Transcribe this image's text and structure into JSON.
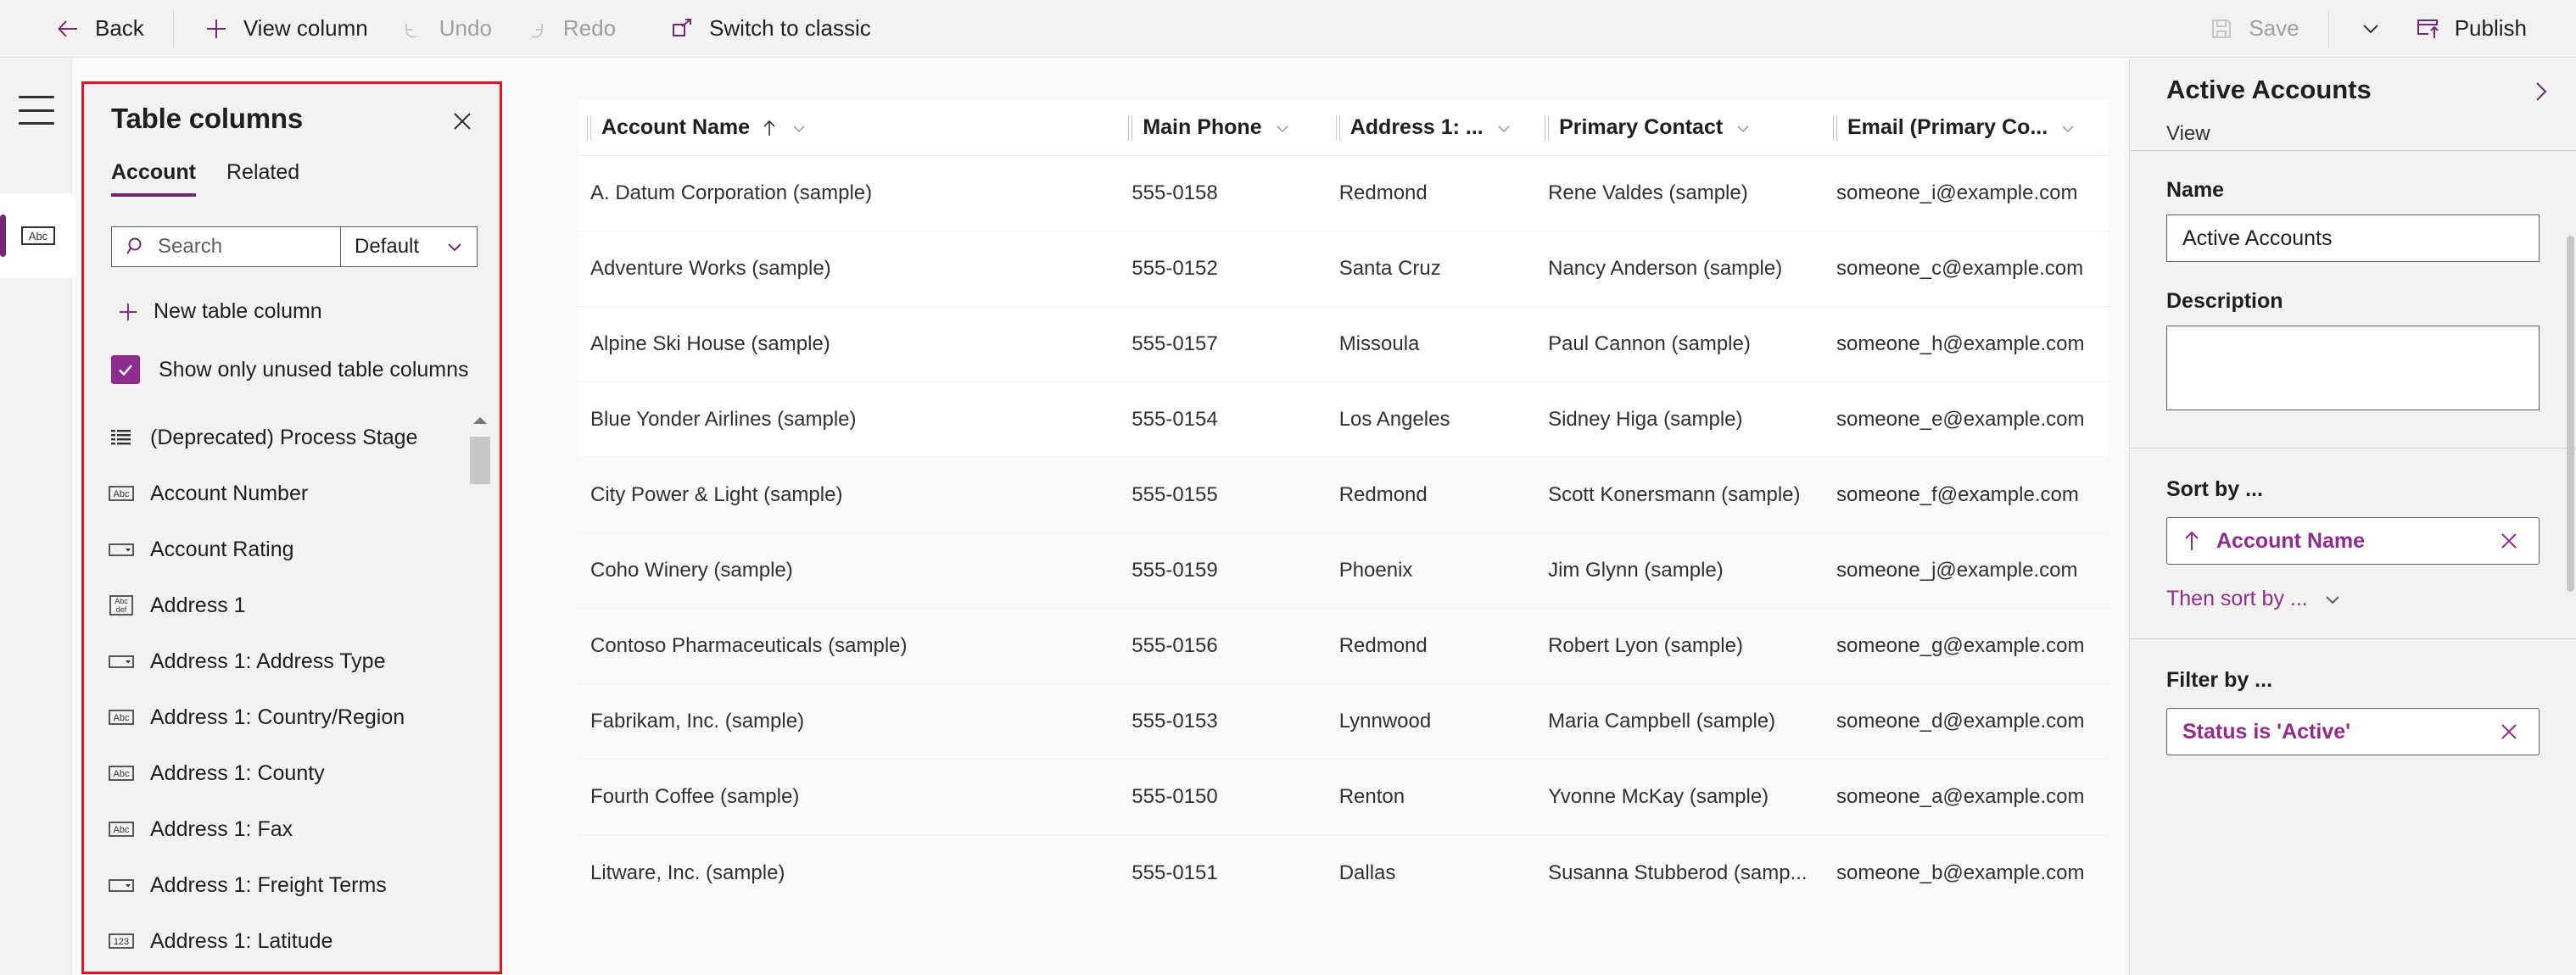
{
  "commandbar": {
    "back": {
      "label": "Back",
      "icon": "arrow-left-icon",
      "disabled": false
    },
    "view_column": {
      "label": "View column",
      "icon": "plus-icon",
      "disabled": false
    },
    "undo": {
      "label": "Undo",
      "icon": "undo-icon",
      "disabled": true
    },
    "redo": {
      "label": "Redo",
      "icon": "redo-icon",
      "disabled": true
    },
    "switch_classic": {
      "label": "Switch to classic",
      "icon": "open-external-icon",
      "disabled": false
    },
    "save": {
      "label": "Save",
      "icon": "save-icon",
      "disabled": true
    },
    "save_chevron": {
      "icon": "chevron-down-icon"
    },
    "publish": {
      "label": "Publish",
      "icon": "publish-icon",
      "disabled": false
    }
  },
  "rail": {
    "hamburger": "hamburger-icon",
    "items": [
      {
        "name": "columns-rail-item",
        "icon": "abc-text-icon",
        "selected": true
      }
    ]
  },
  "table_columns_panel": {
    "title": "Table columns",
    "close_icon": "close-icon",
    "tabs": [
      {
        "label": "Account",
        "active": true
      },
      {
        "label": "Related",
        "active": false
      }
    ],
    "search": {
      "placeholder": "Search",
      "value": "",
      "icon": "search-icon"
    },
    "filter_dropdown": {
      "value": "Default",
      "icon": "chevron-down-icon"
    },
    "new_column": {
      "label": "New table column",
      "icon": "plus-icon"
    },
    "show_unused": {
      "label": "Show only unused table columns",
      "checked": true
    },
    "columns": [
      {
        "label": "(Deprecated) Process Stage",
        "icon": "list-icon"
      },
      {
        "label": "Account Number",
        "icon": "abc-text-icon"
      },
      {
        "label": "Account Rating",
        "icon": "choice-icon"
      },
      {
        "label": "Address 1",
        "icon": "abcdef-multiline-icon"
      },
      {
        "label": "Address 1: Address Type",
        "icon": "choice-icon"
      },
      {
        "label": "Address 1: Country/Region",
        "icon": "abc-text-icon"
      },
      {
        "label": "Address 1: County",
        "icon": "abc-text-icon"
      },
      {
        "label": "Address 1: Fax",
        "icon": "abc-text-icon"
      },
      {
        "label": "Address 1: Freight Terms",
        "icon": "choice-icon"
      },
      {
        "label": "Address 1: Latitude",
        "icon": "number-123-icon"
      }
    ],
    "scrollbar": {
      "up_icon": "caret-up-icon"
    }
  },
  "grid": {
    "columns": [
      {
        "label": "Account Name",
        "sort": "ascending",
        "sort_icon": "arrow-up-icon",
        "menu_icon": "chevron-down-icon",
        "key": "name"
      },
      {
        "label": "Main Phone",
        "sort": "",
        "sort_icon": "",
        "menu_icon": "chevron-down-icon",
        "key": "phone"
      },
      {
        "label": "Address 1: ...",
        "sort": "",
        "sort_icon": "",
        "menu_icon": "chevron-down-icon",
        "key": "city"
      },
      {
        "label": "Primary Contact",
        "sort": "",
        "sort_icon": "",
        "menu_icon": "chevron-down-icon",
        "key": "contact"
      },
      {
        "label": "Email (Primary Co...",
        "sort": "",
        "sort_icon": "",
        "menu_icon": "chevron-down-icon",
        "key": "email"
      }
    ],
    "rows": [
      {
        "name": "A. Datum Corporation (sample)",
        "phone": "555-0158",
        "city": "Redmond",
        "contact": "Rene Valdes (sample)",
        "email": "someone_i@example.com"
      },
      {
        "name": "Adventure Works (sample)",
        "phone": "555-0152",
        "city": "Santa Cruz",
        "contact": "Nancy Anderson (sample)",
        "email": "someone_c@example.com"
      },
      {
        "name": "Alpine Ski House (sample)",
        "phone": "555-0157",
        "city": "Missoula",
        "contact": "Paul Cannon (sample)",
        "email": "someone_h@example.com"
      },
      {
        "name": "Blue Yonder Airlines (sample)",
        "phone": "555-0154",
        "city": "Los Angeles",
        "contact": "Sidney Higa (sample)",
        "email": "someone_e@example.com"
      },
      {
        "name": "City Power & Light (sample)",
        "phone": "555-0155",
        "city": "Redmond",
        "contact": "Scott Konersmann (sample)",
        "email": "someone_f@example.com"
      },
      {
        "name": "Coho Winery (sample)",
        "phone": "555-0159",
        "city": "Phoenix",
        "contact": "Jim Glynn (sample)",
        "email": "someone_j@example.com"
      },
      {
        "name": "Contoso Pharmaceuticals (sample)",
        "phone": "555-0156",
        "city": "Redmond",
        "contact": "Robert Lyon (sample)",
        "email": "someone_g@example.com"
      },
      {
        "name": "Fabrikam, Inc. (sample)",
        "phone": "555-0153",
        "city": "Lynnwood",
        "contact": "Maria Campbell (sample)",
        "email": "someone_d@example.com"
      },
      {
        "name": "Fourth Coffee (sample)",
        "phone": "555-0150",
        "city": "Renton",
        "contact": "Yvonne McKay (sample)",
        "email": "someone_a@example.com"
      },
      {
        "name": "Litware, Inc. (sample)",
        "phone": "555-0151",
        "city": "Dallas",
        "contact": "Susanna Stubberod (samp...",
        "email": "someone_b@example.com"
      }
    ]
  },
  "properties_panel": {
    "title": "Active Accounts",
    "subtitle": "View",
    "expand_icon": "chevron-right-icon",
    "name_label": "Name",
    "name_value": "Active Accounts",
    "description_label": "Description",
    "description_value": "",
    "sort_by_label": "Sort by ...",
    "sort_pill": {
      "text": "Account Name",
      "direction_icon": "arrow-up-icon",
      "remove_icon": "close-icon"
    },
    "then_sort_by": {
      "label": "Then sort by ...",
      "icon": "chevron-down-icon"
    },
    "filter_by_label": "Filter by ...",
    "filter_pill": {
      "text": "Status is 'Active'",
      "remove_icon": "close-icon"
    }
  },
  "colors": {
    "accent": "#742774",
    "accent_light": "#8f2d8f",
    "highlight_border": "#e81123",
    "chrome": "#f3f2f1",
    "text": "#201f1e",
    "muted": "#a19f9d"
  }
}
